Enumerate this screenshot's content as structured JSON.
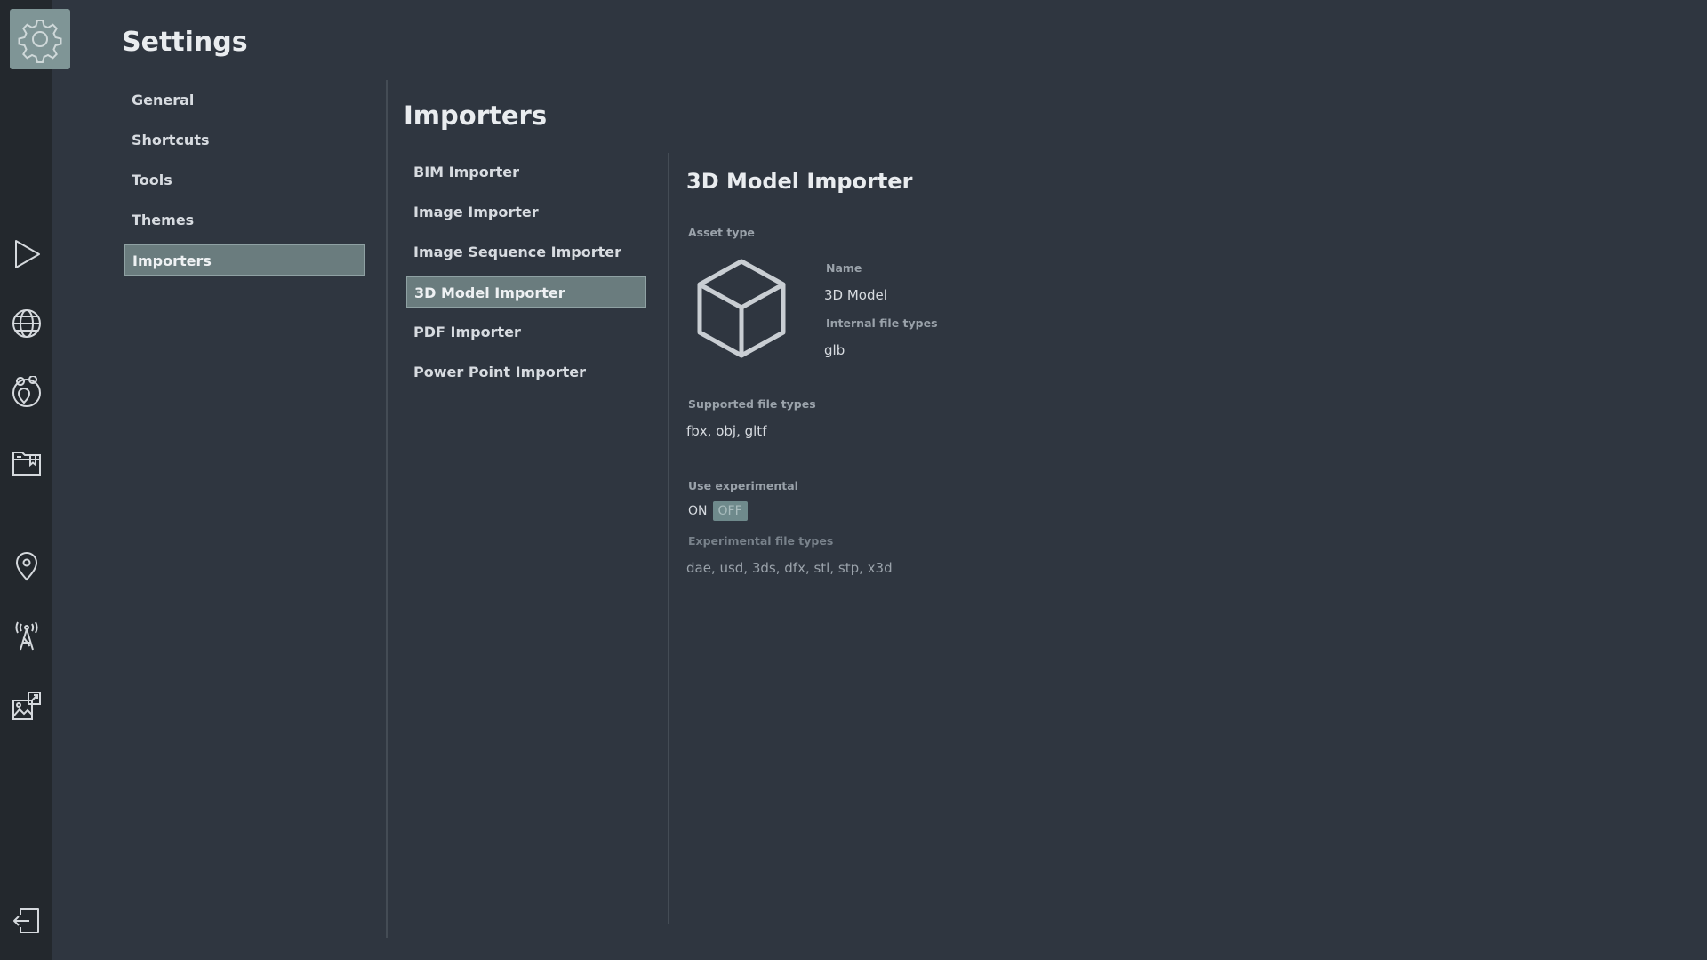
{
  "page": {
    "title": "Settings"
  },
  "rail": {
    "icons": [
      "gear-icon",
      "play-icon",
      "globe-icon",
      "map-pins-icon",
      "folder-bookmark-icon",
      "location-pin-icon",
      "antenna-tower-icon",
      "puzzle-picture-icon",
      "logout-icon"
    ]
  },
  "nav": {
    "items": [
      {
        "label": "General"
      },
      {
        "label": "Shortcuts"
      },
      {
        "label": "Tools"
      },
      {
        "label": "Themes"
      },
      {
        "label": "Importers",
        "active": true
      }
    ]
  },
  "importers": {
    "title": "Importers",
    "items": [
      {
        "label": "BIM Importer"
      },
      {
        "label": "Image Importer"
      },
      {
        "label": "Image Sequence Importer"
      },
      {
        "label": "3D Model Importer",
        "active": true
      },
      {
        "label": "PDF Importer"
      },
      {
        "label": "Power Point Importer"
      }
    ]
  },
  "detail": {
    "title": "3D Model Importer",
    "asset_type_label": "Asset type",
    "asset_icon": "cube-icon",
    "name_label": "Name",
    "name_value": "3D Model",
    "internal_types_label": "Internal file types",
    "internal_types_value": "glb",
    "supported_label": "Supported file types",
    "supported_value": "fbx, obj, gltf",
    "experimental_label": "Use experimental",
    "toggle_on": "ON",
    "toggle_off": "OFF",
    "toggle_state": "OFF",
    "experimental_types_label": "Experimental file types",
    "experimental_types_value": "dae, usd, 3ds, dfx, stl, stp, x3d"
  },
  "colors": {
    "background": "#2f3640",
    "rail": "#23282d",
    "accent": "#6a7c7e",
    "app_tile": "#7f9596"
  }
}
